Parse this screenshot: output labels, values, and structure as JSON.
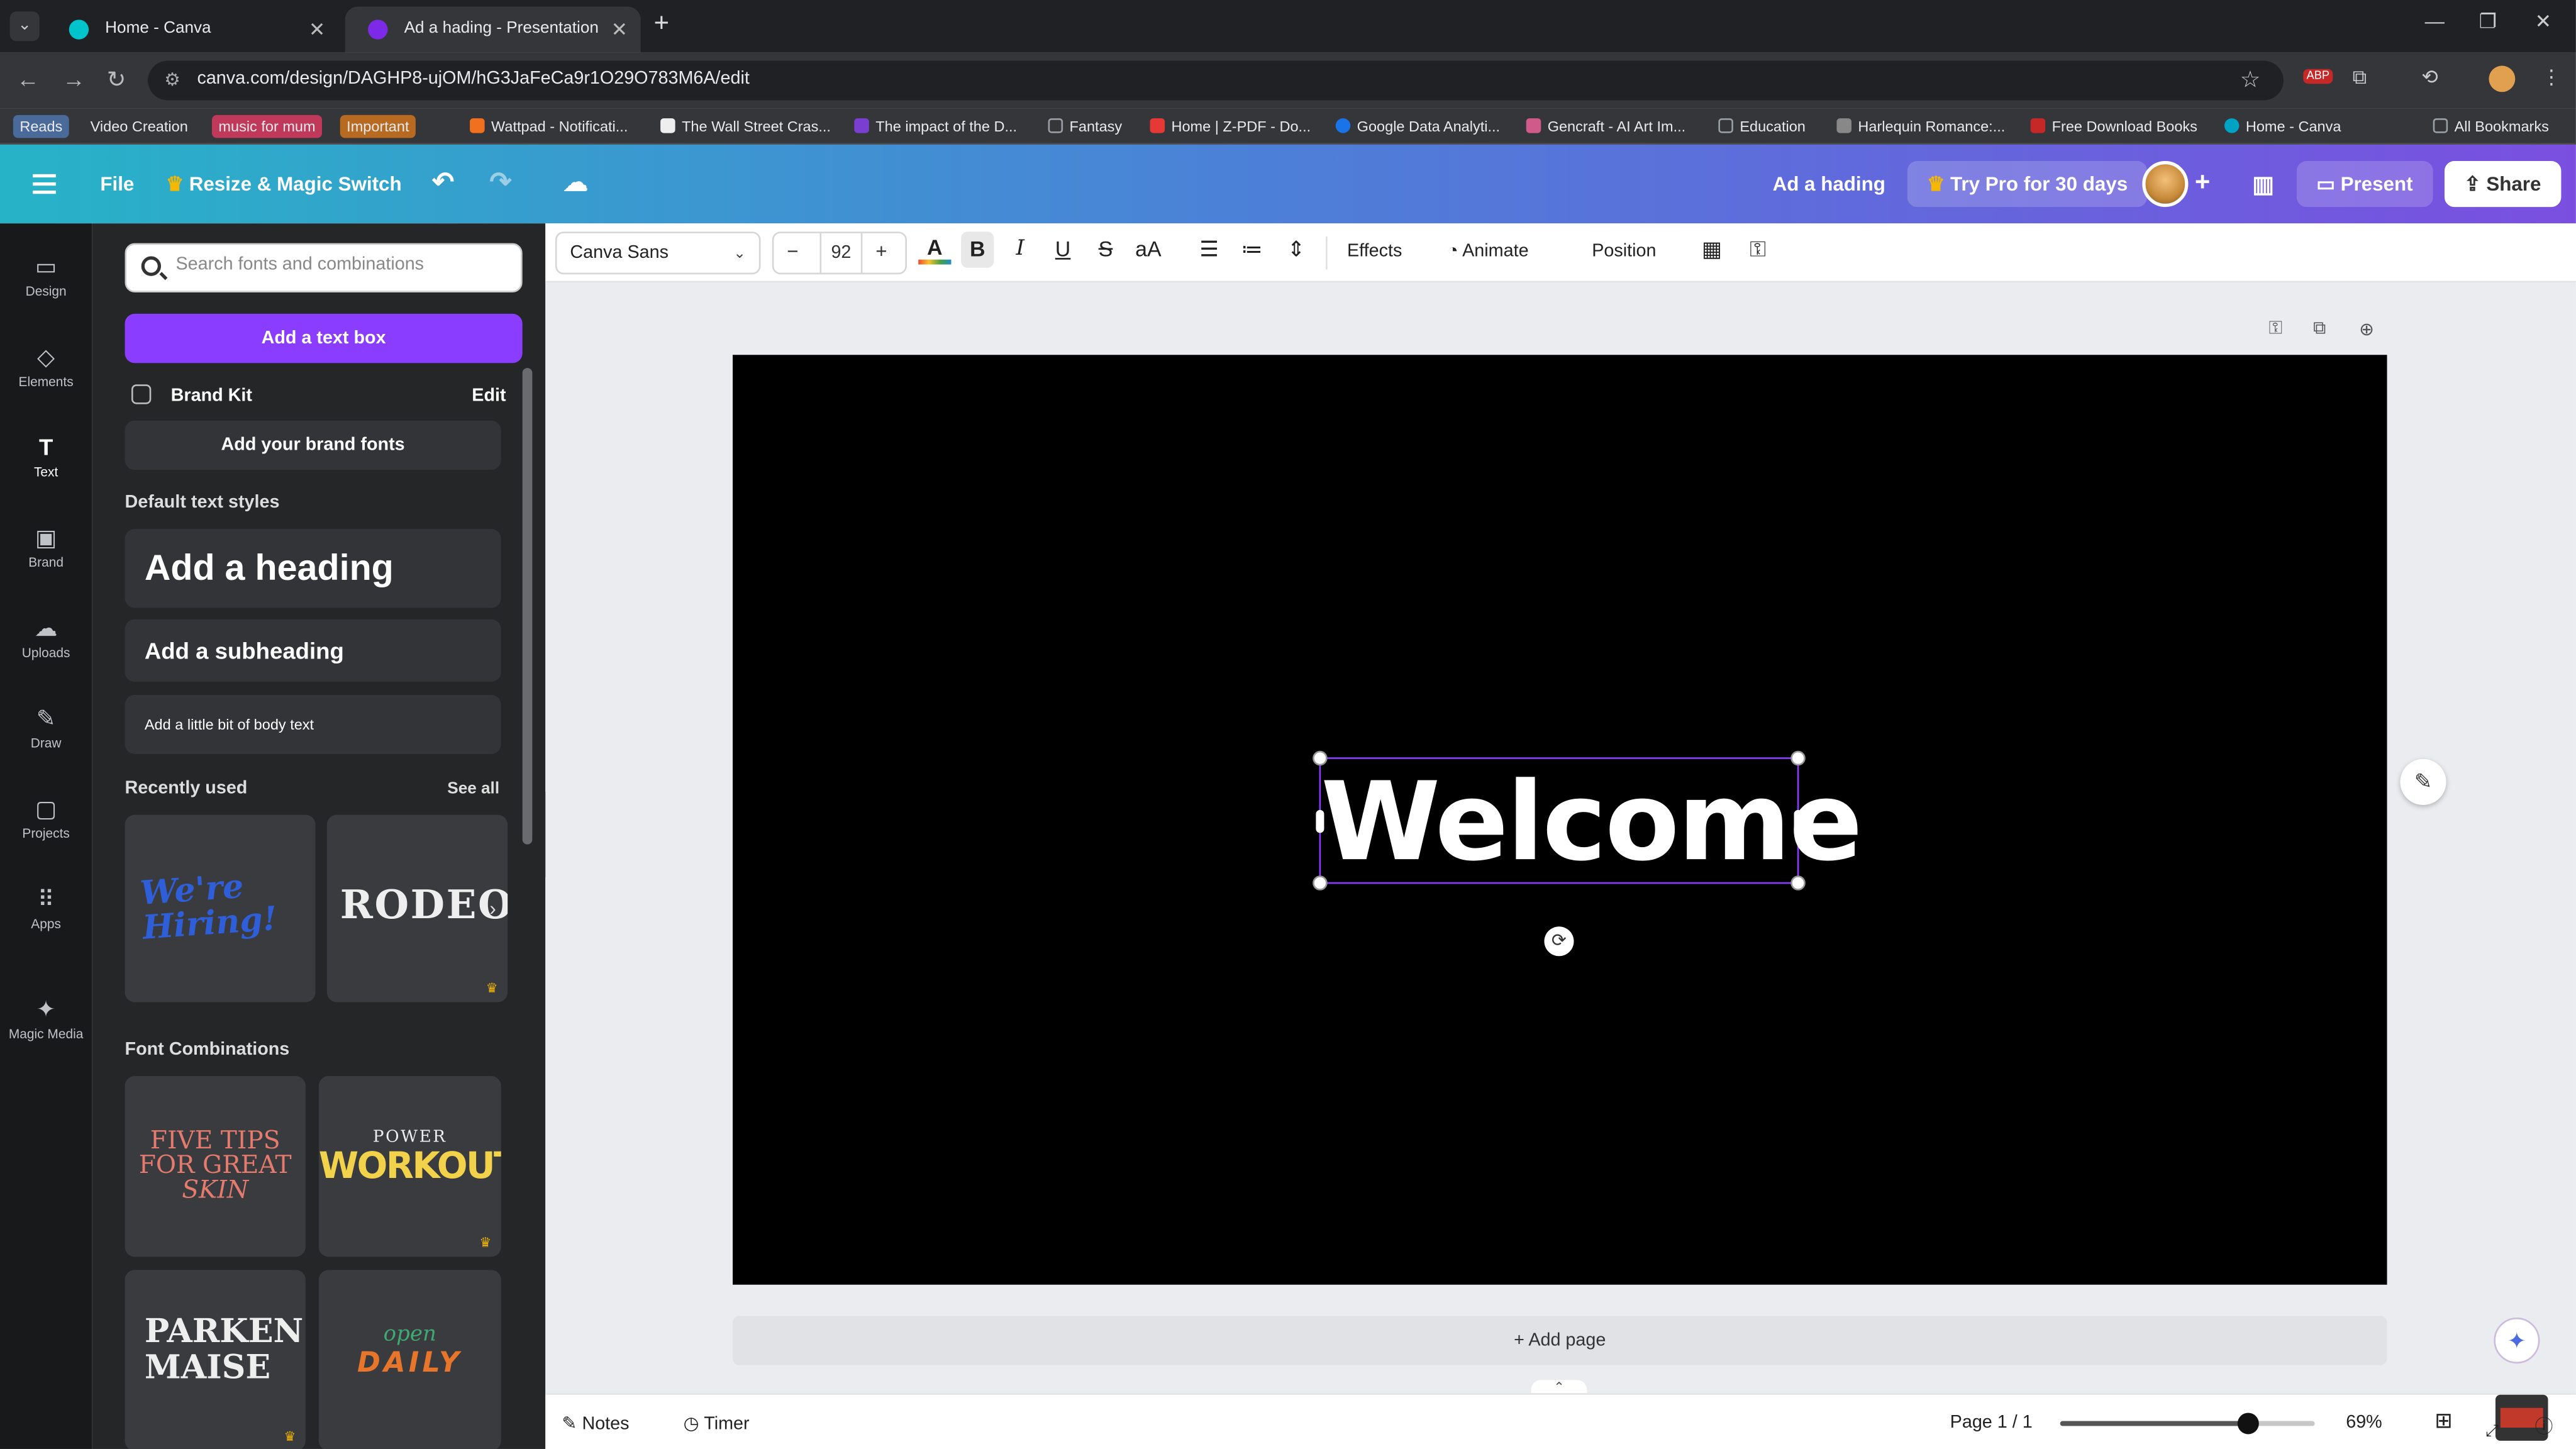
{
  "browser": {
    "tabs": [
      {
        "title": "Home - Canva",
        "active": false
      },
      {
        "title": "Ad a hading - Presentation",
        "active": true
      }
    ],
    "url": "canva.com/design/DAGHP8-ujOM/hG3JaFeCa9r1O29O783M6A/edit",
    "bookmarks": [
      {
        "label": "Reads",
        "color": "#4a6a9a"
      },
      {
        "label": "Video Creation",
        "color": ""
      },
      {
        "label": "music for mum",
        "color": "#c0395a"
      },
      {
        "label": "Important",
        "color": "#b86a20"
      },
      {
        "label": "Wattpad - Notificati...",
        "color": "#f07020"
      },
      {
        "label": "The Wall Street Cras...",
        "color": "#222222"
      },
      {
        "label": "The impact of the D...",
        "color": "#7a3fd0"
      },
      {
        "label": "Fantasy",
        "color": "#9aa0a6"
      },
      {
        "label": "Home | Z-PDF - Do...",
        "color": "#e53935"
      },
      {
        "label": "Google Data Analyti...",
        "color": "#1a73e8"
      },
      {
        "label": "Gencraft - AI Art Im...",
        "color": "#d05a8a"
      },
      {
        "label": "Education",
        "color": "#9aa0a6"
      },
      {
        "label": "Harlequin Romance:...",
        "color": "#888888"
      },
      {
        "label": "Free Download Books",
        "color": "#c62828"
      },
      {
        "label": "Home - Canva",
        "color": "#00a3c4"
      },
      {
        "label": "All Bookmarks",
        "color": "#9aa0a6"
      }
    ]
  },
  "header": {
    "file": "File",
    "resize": "Resize & Magic Switch",
    "title": "Ad a hading",
    "try_pro": "Try Pro for 30 days",
    "present": "Present",
    "share": "Share"
  },
  "rail": [
    {
      "label": "Design",
      "icon": "design-icon",
      "glyph": "▭"
    },
    {
      "label": "Elements",
      "icon": "elements-icon",
      "glyph": "◇"
    },
    {
      "label": "Text",
      "icon": "text-icon",
      "glyph": "T",
      "active": true
    },
    {
      "label": "Brand",
      "icon": "brand-icon",
      "glyph": "▣"
    },
    {
      "label": "Uploads",
      "icon": "uploads-icon",
      "glyph": "☁"
    },
    {
      "label": "Draw",
      "icon": "draw-icon",
      "glyph": "✎"
    },
    {
      "label": "Projects",
      "icon": "projects-icon",
      "glyph": "▢"
    },
    {
      "label": "Apps",
      "icon": "apps-icon",
      "glyph": "⠿"
    },
    {
      "label": "Magic Media",
      "icon": "magic-media-icon",
      "glyph": "✦"
    }
  ],
  "panel": {
    "search_placeholder": "Search fonts and combinations",
    "add_text_box": "Add a text box",
    "brand_kit": "Brand Kit",
    "edit": "Edit",
    "add_brand_fonts": "Add your brand fonts",
    "default_styles": "Default text styles",
    "heading": "Add a heading",
    "subheading": "Add a subheading",
    "body": "Add a little bit of body text",
    "recently_used": "Recently used",
    "see_all": "See all",
    "recent": [
      "We're Hiring!",
      "RODEO"
    ],
    "font_combinations": "Font Combinations",
    "combos": [
      {
        "line1": "FIVE TIPS",
        "line2": "FOR GREAT",
        "line3": "SKIN"
      },
      {
        "line1": "POWER",
        "line2": "WORKOUT"
      },
      {
        "line1": "PARKEN",
        "line2": "MAISE"
      },
      {
        "line1": "open",
        "line2": "DAILY"
      }
    ]
  },
  "toolbar": {
    "font": "Canva Sans",
    "size": "92",
    "effects": "Effects",
    "animate": "Animate",
    "position": "Position"
  },
  "canvas": {
    "text": "Welcome",
    "add_page": "+ Add page"
  },
  "footer": {
    "notes": "Notes",
    "timer": "Timer",
    "page": "Page 1 / 1",
    "zoom": "69%",
    "zoom_value": 0.69
  }
}
